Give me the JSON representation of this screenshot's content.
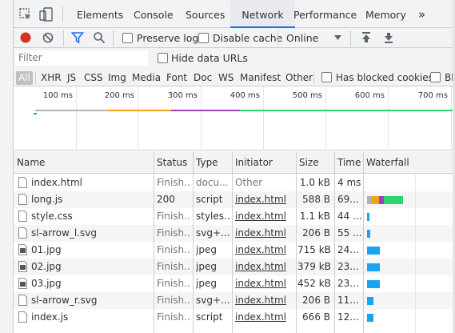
{
  "tabbar": {
    "tabs": [
      "Elements",
      "Console",
      "Sources",
      "Network",
      "Performance",
      "Memory"
    ],
    "active_tab": "Network",
    "more": "»"
  },
  "toolbar": {
    "preserve_log": "Preserve log",
    "disable_cache": "Disable cache",
    "throttling": "Online"
  },
  "filter": {
    "placeholder": "Filter",
    "hide_data_urls": "Hide data URLs"
  },
  "types": {
    "all": "All",
    "items": [
      "XHR",
      "JS",
      "CSS",
      "Img",
      "Media",
      "Font",
      "Doc",
      "WS",
      "Manifest",
      "Other"
    ],
    "has_blocked_cookies": "Has blocked cookies",
    "blocked_truncated": "Blo"
  },
  "overview": {
    "ticks": [
      "100 ms",
      "200 ms",
      "300 ms",
      "400 ms",
      "500 ms",
      "600 ms",
      "700 ms"
    ]
  },
  "table": {
    "headers": [
      "Name",
      "Status",
      "Type",
      "Initiator",
      "Size",
      "Time",
      "Waterfall"
    ],
    "rows": [
      {
        "name": "index.html",
        "icon": "document-icon",
        "status": "Finish...",
        "type": "docu...",
        "initiator": "Other",
        "size": "1.0 kB",
        "time": "4 ms"
      },
      {
        "name": "long.js",
        "icon": "document-icon",
        "status": "200",
        "type": "script",
        "initiator": "index.html",
        "size": "588 B",
        "time": "69..."
      },
      {
        "name": "style.css",
        "icon": "document-icon",
        "status": "Finish...",
        "type": "styles...",
        "initiator": "index.html",
        "size": "1.1 kB",
        "time": "44 ..."
      },
      {
        "name": "sl-arrow_l.svg",
        "icon": "document-icon",
        "status": "Finish...",
        "type": "svg+...",
        "initiator": "index.html",
        "size": "206 B",
        "time": "55 ..."
      },
      {
        "name": "01.jpg",
        "icon": "image-icon",
        "status": "Finish...",
        "type": "jpeg",
        "initiator": "index.html",
        "size": "715 kB",
        "time": "24..."
      },
      {
        "name": "02.jpg",
        "icon": "image-icon",
        "status": "Finish...",
        "type": "jpeg",
        "initiator": "index.html",
        "size": "379 kB",
        "time": "23..."
      },
      {
        "name": "03.jpg",
        "icon": "image-icon",
        "status": "Finish...",
        "type": "jpeg",
        "initiator": "index.html",
        "size": "452 kB",
        "time": "23..."
      },
      {
        "name": "sl-arrow_r.svg",
        "icon": "document-icon",
        "status": "Finish...",
        "type": "svg+...",
        "initiator": "index.html",
        "size": "206 B",
        "time": "11..."
      },
      {
        "name": "index.js",
        "icon": "document-icon",
        "status": "Finish...",
        "type": "script",
        "initiator": "index.html",
        "size": "666 B",
        "time": "12..."
      }
    ]
  },
  "colors": {
    "accent": "#1a73e8",
    "record": "#d93025",
    "waterfall_blue": "#1aa3f0",
    "waterfall_green": "#2fd46c",
    "waterfall_purple": "#9b3fbf",
    "waterfall_orange": "#f0a21a",
    "waterfall_gray": "#b3b3b3"
  }
}
